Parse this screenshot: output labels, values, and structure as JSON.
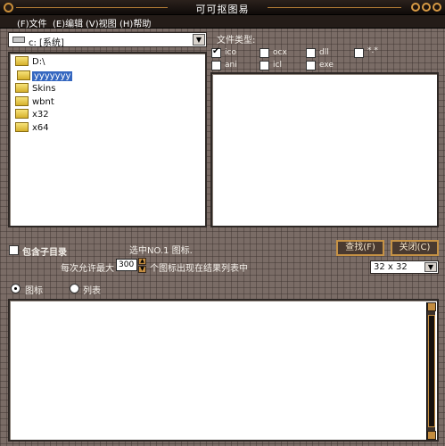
{
  "window": {
    "title": "可可抠图易"
  },
  "menu": [
    {
      "label": "(F)文件"
    },
    {
      "label": "(E)编辑"
    },
    {
      "label": "(V)视图"
    },
    {
      "label": "(H)帮助"
    }
  ],
  "drive": {
    "value": "c: [系统]"
  },
  "folders": [
    {
      "label": "D:\\",
      "selected": false
    },
    {
      "label": "yyyyyyy",
      "selected": true
    },
    {
      "label": "Skins",
      "selected": false
    },
    {
      "label": "wbnt",
      "selected": false
    },
    {
      "label": "x32",
      "selected": false
    },
    {
      "label": "x64",
      "selected": false
    }
  ],
  "file_types": {
    "label": "文件类型:",
    "options": [
      {
        "label": "ico",
        "checked": true
      },
      {
        "label": "ocx",
        "checked": false
      },
      {
        "label": "dll",
        "checked": false
      },
      {
        "label": "*.*",
        "checked": false
      },
      {
        "label": "ani",
        "checked": false
      },
      {
        "label": "icl",
        "checked": false
      },
      {
        "label": "exe",
        "checked": false
      }
    ]
  },
  "options": {
    "include_subdirs_label": "包含子目录",
    "include_subdirs_checked": false,
    "selected_status": "选中NO.1 图标.",
    "max_prefix": "每次允许最大",
    "max_value": "300",
    "max_suffix": "个图标出现在结果列表中",
    "icon_size": "32 x 32"
  },
  "buttons": {
    "search": "查找(F)",
    "close": "关闭(C)"
  },
  "view_modes": [
    {
      "label": "图标",
      "selected": true
    },
    {
      "label": "列表",
      "selected": false
    }
  ],
  "colors": {
    "accent": "#c69245",
    "selection": "#3567c0"
  }
}
